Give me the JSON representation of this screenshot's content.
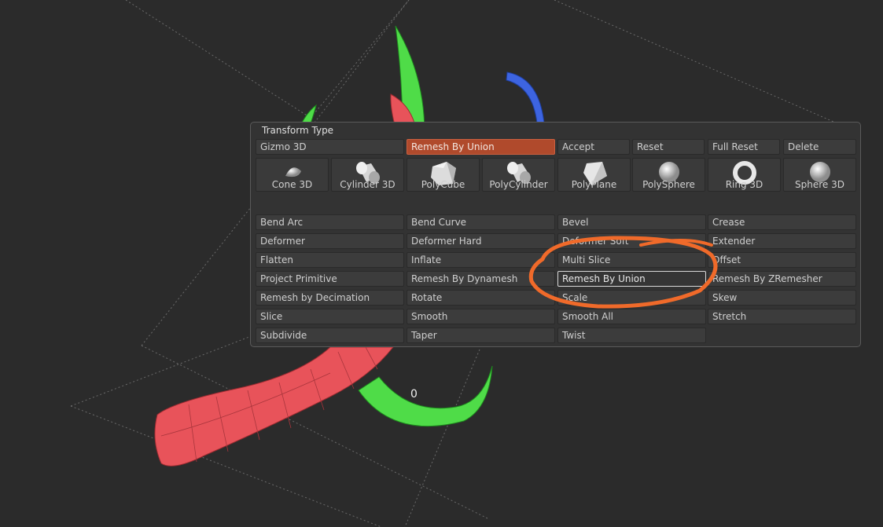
{
  "panel": {
    "title": "Transform Type"
  },
  "top_buttons": [
    {
      "id": "gizmo3d",
      "label": "Gizmo 3D",
      "state": "normal"
    },
    {
      "id": "remesh-by-union-active",
      "label": "Remesh By Union",
      "state": "active"
    },
    {
      "id": "accept",
      "label": "Accept",
      "state": "normal"
    },
    {
      "id": "reset",
      "label": "Reset",
      "state": "normal"
    },
    {
      "id": "full-reset",
      "label": "Full Reset",
      "state": "normal"
    },
    {
      "id": "delete",
      "label": "Delete",
      "state": "normal"
    }
  ],
  "primitives": [
    {
      "label": "Cone 3D",
      "icon": "cone-icon"
    },
    {
      "label": "Cylinder 3D",
      "icon": "cylinder-icon"
    },
    {
      "label": "PolyCube",
      "icon": "cube-icon"
    },
    {
      "label": "PolyCylinder",
      "icon": "cylinder-icon"
    },
    {
      "label": "PolyPlane",
      "icon": "plane-icon"
    },
    {
      "label": "PolySphere",
      "icon": "sphere-icon"
    },
    {
      "label": "Ring 3D",
      "icon": "ring-icon"
    },
    {
      "label": "Sphere 3D",
      "icon": "sphere-icon"
    }
  ],
  "deformers": [
    [
      "Bend Arc",
      "Bend Curve",
      "Bevel",
      "Crease"
    ],
    [
      "Deformer",
      "Deformer Hard",
      "Deformer Soft",
      "Extender"
    ],
    [
      "Flatten",
      "Inflate",
      "Multi Slice",
      "Offset"
    ],
    [
      "Project Primitive",
      "Remesh By Dynamesh",
      "Remesh By Union",
      "Remesh By ZRemesher"
    ],
    [
      "Remesh by Decimation",
      "Rotate",
      "Scale",
      "Skew"
    ],
    [
      "Slice",
      "Smooth",
      "Smooth All",
      "Stretch"
    ],
    [
      "Subdivide",
      "Taper",
      "Twist",
      ""
    ]
  ],
  "selected_deformer": "Remesh By Union",
  "viewport": {
    "counter": "0"
  },
  "colors": {
    "accent": "#b04a2c",
    "annotation": "#f06a2a",
    "red_mesh": "#e8535a",
    "green_mesh": "#4fdc48",
    "blue_mesh": "#3d64e0"
  }
}
